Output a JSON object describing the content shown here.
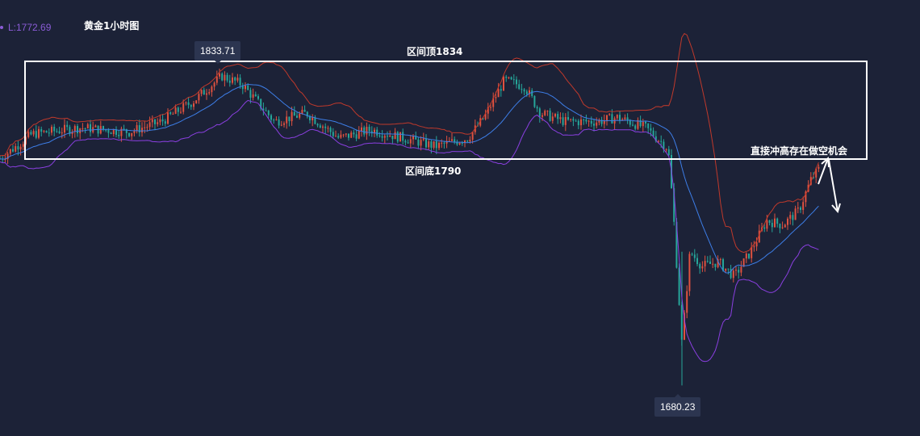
{
  "header": {
    "low_label": "L:1772.69",
    "title": "黄金1小时图"
  },
  "annotations": {
    "range_top": "区间顶1834",
    "range_bottom": "区间底1790",
    "short_note": "直接冲高存在做空机会",
    "high_tag": "1833.71",
    "low_tag": "1680.23"
  },
  "colors": {
    "background": "#1c2237",
    "up_candle": "#e0523f",
    "down_candle": "#26a69a",
    "middle_band": "#3d7ee8",
    "upper_band": "#c0392b",
    "lower_band": "#8a3fe0",
    "annotation": "#ffffff"
  },
  "chart_data": {
    "type": "candlestick",
    "title": "黄金1小时图",
    "indicator": "Bollinger Bands (upper, middle, lower)",
    "ylim": [
      1675,
      1845
    ],
    "range_box": {
      "top": 1834,
      "bottom": 1790
    },
    "marked_high": 1833.71,
    "marked_low": 1680.23,
    "lower_band_last": 1772.69,
    "close_path": [
      {
        "x": 0,
        "close": 1790
      },
      {
        "x": 40,
        "close": 1802
      },
      {
        "x": 100,
        "close": 1805
      },
      {
        "x": 160,
        "close": 1803
      },
      {
        "x": 200,
        "close": 1808
      },
      {
        "x": 240,
        "close": 1818
      },
      {
        "x": 275,
        "close": 1830
      },
      {
        "x": 300,
        "close": 1826
      },
      {
        "x": 340,
        "close": 1808
      },
      {
        "x": 380,
        "close": 1812
      },
      {
        "x": 420,
        "close": 1800
      },
      {
        "x": 460,
        "close": 1804
      },
      {
        "x": 500,
        "close": 1800
      },
      {
        "x": 540,
        "close": 1796
      },
      {
        "x": 580,
        "close": 1800
      },
      {
        "x": 600,
        "close": 1810
      },
      {
        "x": 625,
        "close": 1828
      },
      {
        "x": 650,
        "close": 1825
      },
      {
        "x": 670,
        "close": 1812
      },
      {
        "x": 700,
        "close": 1808
      },
      {
        "x": 740,
        "close": 1808
      },
      {
        "x": 765,
        "close": 1810
      },
      {
        "x": 800,
        "close": 1805
      },
      {
        "x": 828,
        "close": 1795
      },
      {
        "x": 835,
        "close": 1760
      },
      {
        "x": 845,
        "close": 1700
      },
      {
        "x": 855,
        "close": 1745
      },
      {
        "x": 870,
        "close": 1738
      },
      {
        "x": 890,
        "close": 1740
      },
      {
        "x": 910,
        "close": 1733
      },
      {
        "x": 930,
        "close": 1745
      },
      {
        "x": 950,
        "close": 1760
      },
      {
        "x": 970,
        "close": 1758
      },
      {
        "x": 990,
        "close": 1765
      },
      {
        "x": 1005,
        "close": 1780
      },
      {
        "x": 1015,
        "close": 1785
      }
    ]
  }
}
